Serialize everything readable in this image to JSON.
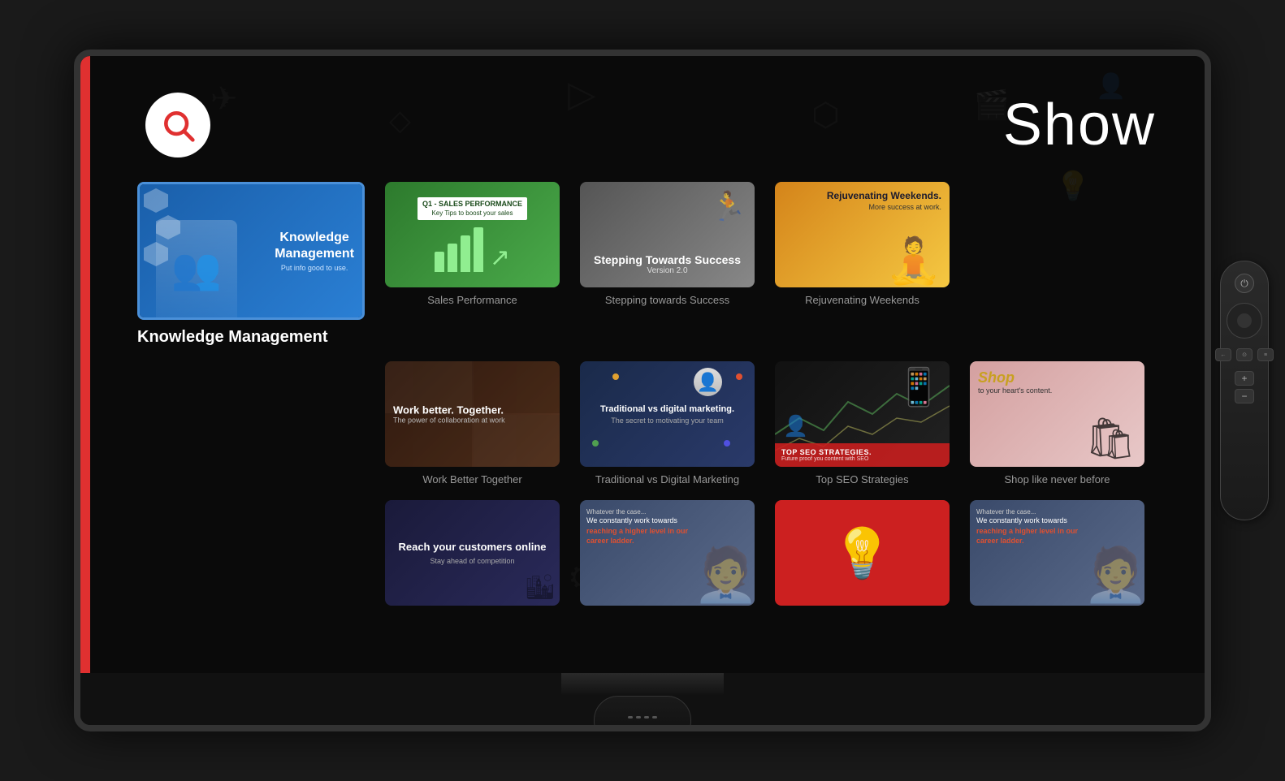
{
  "header": {
    "title": "Show",
    "search_label": "Search"
  },
  "featured": {
    "label": "Knowledge Management",
    "thumb_title_line1": "Knowledge",
    "thumb_title_line2": "Management",
    "thumb_subtitle": "Put info good to use."
  },
  "grid": [
    {
      "id": "sales-performance",
      "label": "Sales Performance",
      "thumb_type": "sales",
      "q1_label": "Q1 - SALES PERFORMANCE",
      "q1_sub": "Key Tips to boost your sales"
    },
    {
      "id": "stepping-success",
      "label": "Stepping towards Success",
      "thumb_type": "stepping",
      "title": "Stepping Towards Success",
      "subtitle": "Version 2.0"
    },
    {
      "id": "rejuvenating",
      "label": "Rejuvenating Weekends",
      "thumb_type": "rejuvenating",
      "title": "Rejuvenating Weekends.",
      "subtitle": "More success at work."
    },
    {
      "id": "work-better",
      "label": "Work Better Together",
      "thumb_type": "workbetter",
      "title": "Work better. Together.",
      "subtitle": "The power of collaboration at work"
    },
    {
      "id": "traditional-digital",
      "label": "Traditional vs Digital Marketing",
      "thumb_type": "traditional",
      "title": "Traditional vs digital marketing.",
      "subtitle": "The secret to motivating your team"
    },
    {
      "id": "top-seo",
      "label": "Top SEO Strategies",
      "thumb_type": "seo",
      "overlay_text": "TOP SEO STRATEGIES.",
      "overlay_sub": "Future proof you content with SEO"
    },
    {
      "id": "shop",
      "label": "Shop like never before",
      "thumb_type": "shop",
      "title": "Shop",
      "subtitle": "to your heart's content."
    },
    {
      "id": "reach-customers",
      "label": "Reach your customers online",
      "thumb_type": "reach",
      "title": "Reach your customers online",
      "subtitle": "Stay ahead of competition"
    },
    {
      "id": "career1",
      "label": "",
      "thumb_type": "career1",
      "whatever": "Whatever the case...",
      "text": "We constantly work towards reaching a higher level in our career ladder."
    },
    {
      "id": "bulb",
      "label": "",
      "thumb_type": "bulb"
    },
    {
      "id": "career2",
      "label": "",
      "thumb_type": "career2",
      "whatever": "Whatever the case...",
      "text": "We constantly work towards reaching a higher level in our career ladder."
    }
  ],
  "remote": {
    "power_symbol": "⏻",
    "plus": "+",
    "minus": "−",
    "back_label": "←",
    "home_label": "⊙",
    "menu_label": "≡"
  }
}
